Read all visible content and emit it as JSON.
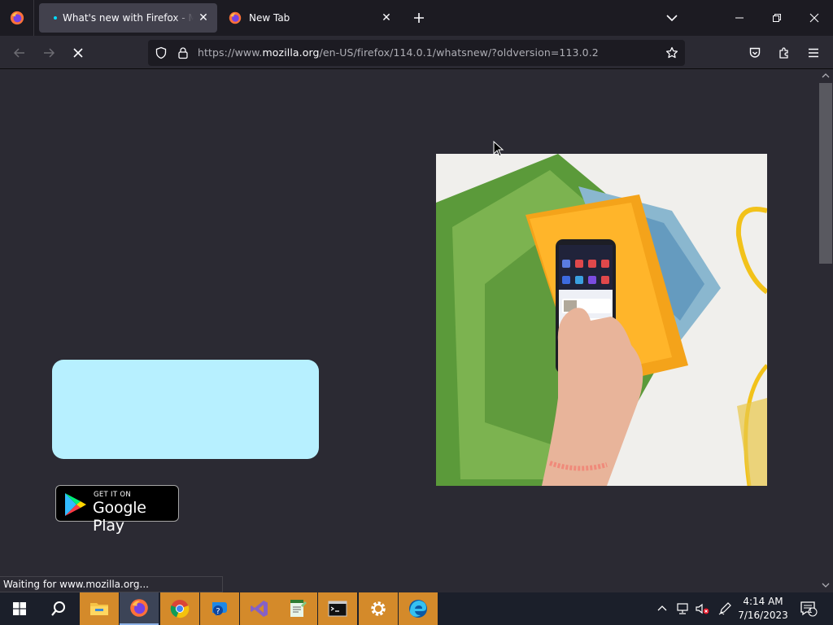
{
  "browser": {
    "tabs": [
      {
        "title": "What's new with Firefox - More",
        "active": true
      },
      {
        "title": "New Tab",
        "active": false
      }
    ],
    "url": {
      "prefix": "https://www.",
      "host": "mozilla.org",
      "path": "/en-US/firefox/114.0.1/whatsnew/?oldversion=113.0.2"
    },
    "status_text": "Waiting for www.mozilla.org..."
  },
  "page": {
    "store_badge": {
      "small": "GET IT ON",
      "big": "Google Play"
    }
  },
  "taskbar": {
    "time": "4:14 AM",
    "date": "7/16/2023",
    "notification_count": "1"
  },
  "colors": {
    "accent_cyan": "#b7f0ff",
    "page_bg": "#2b2a33",
    "taskbar_running": "#d48a2a"
  }
}
